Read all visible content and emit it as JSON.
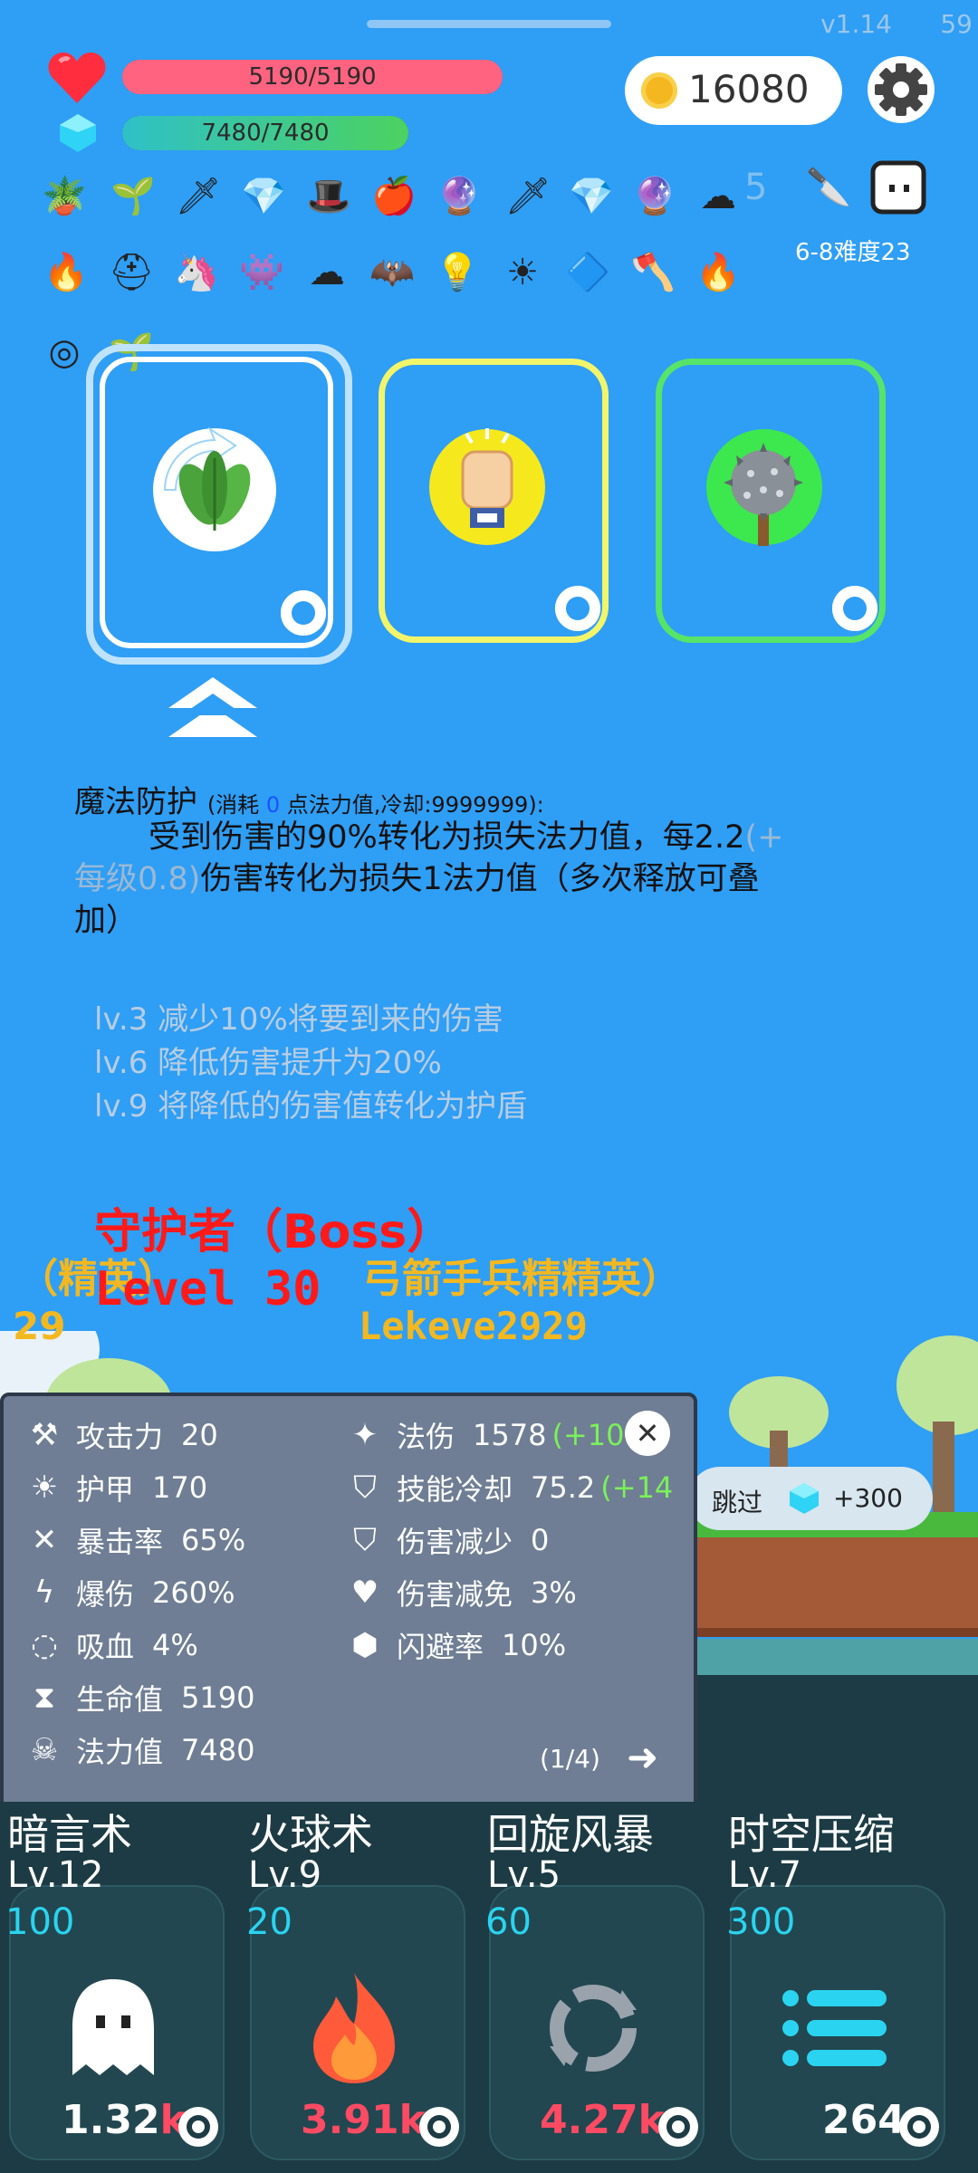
{
  "top": {
    "version": "v1.14",
    "fps": "59"
  },
  "hp": {
    "text": "5190/5190",
    "fraction": 1.0
  },
  "mp": {
    "text": "7480/7480",
    "fraction": 1.0
  },
  "coins": "16080",
  "faded_number": "5",
  "difficulty": "6-8难度23",
  "skill_desc": {
    "name": "魔法防护",
    "meta_prefix": "(消耗 ",
    "cost": "0",
    "meta_suffix": " 点法力值,冷却:9999999):",
    "line1_main": "受到伤害的90%转化为损失法力值，每2.2",
    "line1_grey": "(+",
    "line2_grey": "每级0.8)",
    "line2_main": "伤害转化为损失1法力值（多次释放可叠",
    "line3": "加）",
    "lv3": "lv.3 减少10%将要到来的伤害",
    "lv6": "lv.6 降低伤害提升为20%",
    "lv9": "lv.9 将降低的伤害值转化为护盾"
  },
  "enemies": {
    "boss_name": "守护者（Boss）",
    "boss_level": "Level 30",
    "elite1": "（精英）",
    "elite1_level": "29",
    "elite2": "弓箭手兵精精英）",
    "elite2_level": "Lekeve2929"
  },
  "skip": {
    "label": "跳过",
    "reward": "+300"
  },
  "stats": {
    "left": [
      {
        "label": "攻击力",
        "value": "20"
      },
      {
        "label": "护甲",
        "value": "170"
      },
      {
        "label": "暴击率",
        "value": "65%"
      },
      {
        "label": "爆伤",
        "value": "260%"
      },
      {
        "label": "吸血",
        "value": "4%"
      },
      {
        "label": "生命值",
        "value": "5190"
      },
      {
        "label": "法力值",
        "value": "7480"
      }
    ],
    "right": [
      {
        "label": "法伤",
        "value": "1578",
        "bonus": "(+10"
      },
      {
        "label": "技能冷却",
        "value": "75.2",
        "bonus": "(+14"
      },
      {
        "label": "伤害减少",
        "value": "0",
        "bonus": ""
      },
      {
        "label": "伤害减免",
        "value": "3%",
        "bonus": ""
      },
      {
        "label": "闪避率",
        "value": "10%",
        "bonus": ""
      }
    ],
    "page": "(1/4)",
    "close": "✕",
    "next": "➜"
  },
  "skills": [
    {
      "name": "暗言术",
      "level": "Lv.12",
      "cost": "100",
      "count": "1.32",
      "unit": "k"
    },
    {
      "name": "火球术",
      "level": "Lv.9",
      "cost": "20",
      "count": "3.91",
      "unit": "k"
    },
    {
      "name": "回旋风暴",
      "level": "Lv.5",
      "cost": "60",
      "count": "4.27",
      "unit": "k"
    },
    {
      "name": "时空压缩",
      "level": "Lv.7",
      "cost": "300",
      "count": "264",
      "unit": ""
    }
  ]
}
